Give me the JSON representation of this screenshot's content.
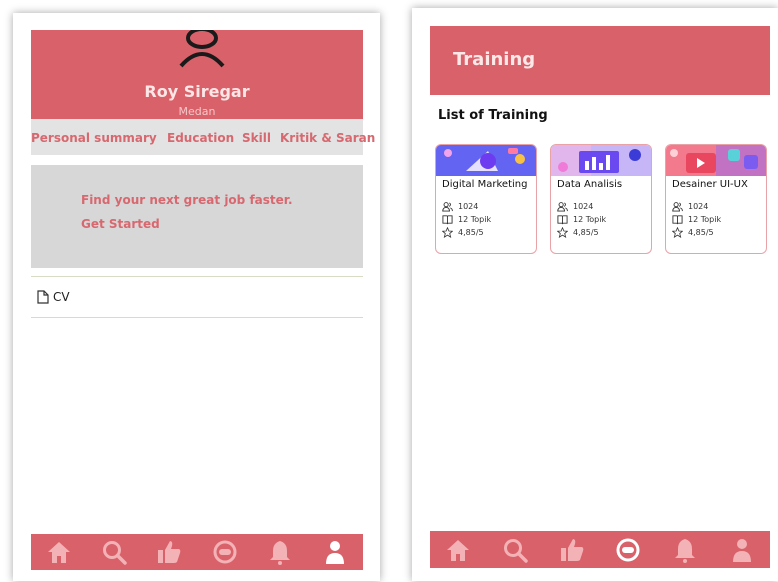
{
  "colors": {
    "accent": "#d9616a",
    "nav_icon": "#f3b2b6",
    "active_icon": "#ffffff",
    "tab_text": "#d8686f"
  },
  "profile": {
    "name": "Roy Siregar",
    "city": "Medan",
    "tabs": [
      {
        "label": "Personal summary"
      },
      {
        "label": "Education"
      },
      {
        "label": "Skill"
      },
      {
        "label": "Kritik & Saran"
      }
    ],
    "promo": {
      "text": "Find your next great job faster.",
      "cta": "Get Started"
    },
    "cv": {
      "label": "CV",
      "icon": "document-icon"
    }
  },
  "training": {
    "header": "Training",
    "list_title": "List of Training",
    "cards": [
      {
        "title": "Digital Marketing",
        "participants": "1024",
        "topics": "12 Topik",
        "rating": "4,85/5"
      },
      {
        "title": "Data Analisis",
        "participants": "1024",
        "topics": "12 Topik",
        "rating": "4,85/5"
      },
      {
        "title": "Desainer UI-UX",
        "participants": "1024",
        "topics": "12 Topik",
        "rating": "4,85/5"
      }
    ]
  },
  "nav": {
    "items": [
      "home-icon",
      "search-icon",
      "thumbs-up-icon",
      "chat-badge-icon",
      "bell-icon",
      "user-icon"
    ],
    "left_active": "user-icon",
    "right_active": "chat-badge-icon"
  }
}
